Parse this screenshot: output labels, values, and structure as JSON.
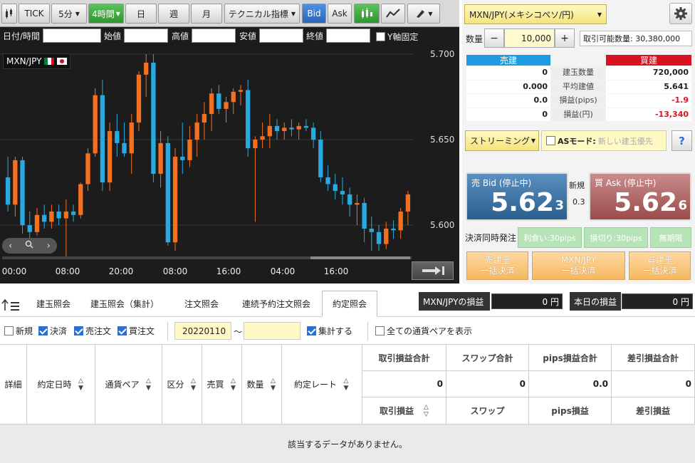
{
  "toolbar": {
    "tick": "TICK",
    "interval_5m": "5分",
    "interval_4h": "4時間",
    "day": "日",
    "week": "週",
    "month": "月",
    "technical": "テクニカル指標",
    "bid": "Bid",
    "ask": "Ask"
  },
  "ohlc": {
    "datetime_label": "日付/時間",
    "open_label": "始値",
    "high_label": "高値",
    "low_label": "安値",
    "close_label": "終値",
    "yfix_label": "Y軸固定"
  },
  "chart": {
    "symbol": "MXN/JPY",
    "accent_up": "#f37021",
    "accent_down": "#29a9df"
  },
  "chart_data": {
    "type": "candlestick",
    "y_ticks": [
      "5.700",
      "5.650",
      "5.600"
    ],
    "x_ticks": [
      "00:00",
      "08:00",
      "20:00",
      "08:00",
      "16:00",
      "04:00",
      "16:00"
    ],
    "ylim": [
      5.578,
      5.705
    ],
    "candles": [
      [
        5.628,
        5.64,
        5.608,
        5.612
      ],
      [
        5.612,
        5.64,
        5.605,
        5.638
      ],
      [
        5.638,
        5.64,
        5.595,
        5.6
      ],
      [
        5.6,
        5.608,
        5.59,
        5.596
      ],
      [
        5.596,
        5.61,
        5.594,
        5.606
      ],
      [
        5.606,
        5.612,
        5.598,
        5.602
      ],
      [
        5.602,
        5.612,
        5.598,
        5.608
      ],
      [
        5.608,
        5.612,
        5.6,
        5.604
      ],
      [
        5.604,
        5.615,
        5.58,
        5.608
      ],
      [
        5.608,
        5.612,
        5.602,
        5.606
      ],
      [
        5.606,
        5.625,
        5.604,
        5.624
      ],
      [
        5.624,
        5.645,
        5.62,
        5.642
      ],
      [
        5.642,
        5.68,
        5.64,
        5.676
      ],
      [
        5.676,
        5.685,
        5.62,
        5.625
      ],
      [
        5.625,
        5.66,
        5.62,
        5.655
      ],
      [
        5.655,
        5.665,
        5.64,
        5.648
      ],
      [
        5.648,
        5.66,
        5.64,
        5.642
      ],
      [
        5.642,
        5.665,
        5.63,
        5.66
      ],
      [
        5.66,
        5.69,
        5.655,
        5.688
      ],
      [
        5.688,
        5.7,
        5.675,
        5.695
      ],
      [
        5.695,
        5.7,
        5.625,
        5.63
      ],
      [
        5.63,
        5.655,
        5.622,
        5.648
      ],
      [
        5.648,
        5.652,
        5.588,
        5.59
      ],
      [
        5.59,
        5.645,
        5.585,
        5.64
      ],
      [
        5.64,
        5.66,
        5.63,
        5.638
      ],
      [
        5.638,
        5.658,
        5.634,
        5.65
      ],
      [
        5.65,
        5.665,
        5.64,
        5.66
      ],
      [
        5.66,
        5.672,
        5.65,
        5.665
      ],
      [
        5.665,
        5.68,
        5.655,
        5.677
      ],
      [
        5.677,
        5.682,
        5.665,
        5.668
      ],
      [
        5.668,
        5.675,
        5.66,
        5.672
      ],
      [
        5.672,
        5.68,
        5.665,
        5.678
      ],
      [
        5.678,
        5.682,
        5.67,
        5.679
      ],
      [
        5.679,
        5.685,
        5.64,
        5.645
      ],
      [
        5.645,
        5.652,
        5.602,
        5.65
      ],
      [
        5.65,
        5.66,
        5.645,
        5.652
      ],
      [
        5.652,
        5.665,
        5.645,
        5.658
      ],
      [
        5.658,
        5.662,
        5.65,
        5.655
      ],
      [
        5.655,
        5.66,
        5.65,
        5.657
      ],
      [
        5.657,
        5.662,
        5.652,
        5.656
      ],
      [
        5.656,
        5.66,
        5.65,
        5.658
      ],
      [
        5.658,
        5.662,
        5.655,
        5.657
      ],
      [
        5.657,
        5.66,
        5.645,
        5.65
      ],
      [
        5.65,
        5.655,
        5.625,
        5.628
      ],
      [
        5.628,
        5.635,
        5.62,
        5.624
      ],
      [
        5.624,
        5.63,
        5.615,
        5.62
      ],
      [
        5.62,
        5.628,
        5.612,
        5.618
      ],
      [
        5.618,
        5.622,
        5.605,
        5.612
      ],
      [
        5.612,
        5.618,
        5.6,
        5.613
      ],
      [
        5.613,
        5.616,
        5.59,
        5.598
      ],
      [
        5.598,
        5.605,
        5.585,
        5.596
      ],
      [
        5.596,
        5.6,
        5.585,
        5.589
      ],
      [
        5.589,
        5.602,
        5.586,
        5.598
      ],
      [
        5.598,
        5.603,
        5.592,
        5.597
      ],
      [
        5.597,
        5.61,
        5.592,
        5.608
      ],
      [
        5.608,
        5.62,
        5.6,
        5.618
      ]
    ]
  },
  "right": {
    "pair_select": "MXN/JPY(メキシコペソ/円)",
    "qty_label": "数量",
    "qty_minus": "−",
    "qty_value": "10,000",
    "qty_plus": "+",
    "available": "取引可能数量: 30,380,000",
    "sell_header": "売建",
    "buy_header": "買建",
    "rows": [
      {
        "sell": "0",
        "label": "建玉数量",
        "buy": "720,000"
      },
      {
        "sell": "0.000",
        "label": "平均建値",
        "buy": "5.641"
      },
      {
        "sell": "0.0",
        "label": "損益(pips)",
        "buy": "-1.9"
      },
      {
        "sell": "0",
        "label": "損益(円)",
        "buy": "-13,340"
      }
    ],
    "streaming": "ストリーミング",
    "as_mode_label": "ASモード:",
    "as_mode_value": "新しい建玉優先",
    "help": "?",
    "bid_label": "売 Bid (停止中)",
    "bid_big": "5.62",
    "bid_small": "3",
    "new_label": "新規",
    "spread": "0.3",
    "ask_label": "買 Ask (停止中)",
    "ask_big": "5.62",
    "ask_small": "6",
    "settle_label": "決済同時発注",
    "takeprofit": "利食い:30pips",
    "stoploss": "損切り:30pips",
    "unlimited": "無期限",
    "close_sell_1": "売建玉",
    "close_sell_2": "一括決済",
    "close_pair_1": "MXN/JPY",
    "close_pair_2": "一括決済",
    "close_buy_1": "買建玉",
    "close_buy_2": "一括決済"
  },
  "bottom": {
    "tabs": [
      "建玉照会",
      "建玉照会（集計）",
      "注文照会",
      "連続予約注文照会",
      "約定照会"
    ],
    "pl_pair_label": "MXN/JPYの損益",
    "pl_pair_value": "0 円",
    "pl_today_label": "本日の損益",
    "pl_today_value": "0 円",
    "filter_new": "新規",
    "filter_settle": "決済",
    "filter_sell": "売注文",
    "filter_buy": "買注文",
    "date_from": "20220110",
    "tilde": "〜",
    "aggregate": "集計する",
    "show_all": "全ての通貨ペアを表示",
    "columns": [
      "詳細",
      "約定日時",
      "通貨ペア",
      "区分",
      "売買",
      "数量",
      "約定レート"
    ],
    "sum_headers": [
      "取引損益合計",
      "スワップ合計",
      "pips損益合計",
      "差引損益合計"
    ],
    "sum_values": [
      "0",
      "0",
      "0.0",
      "0"
    ],
    "sub_headers": [
      "取引損益",
      "スワップ",
      "pips損益",
      "差引損益"
    ],
    "empty_message": "該当するデータがありません。"
  }
}
